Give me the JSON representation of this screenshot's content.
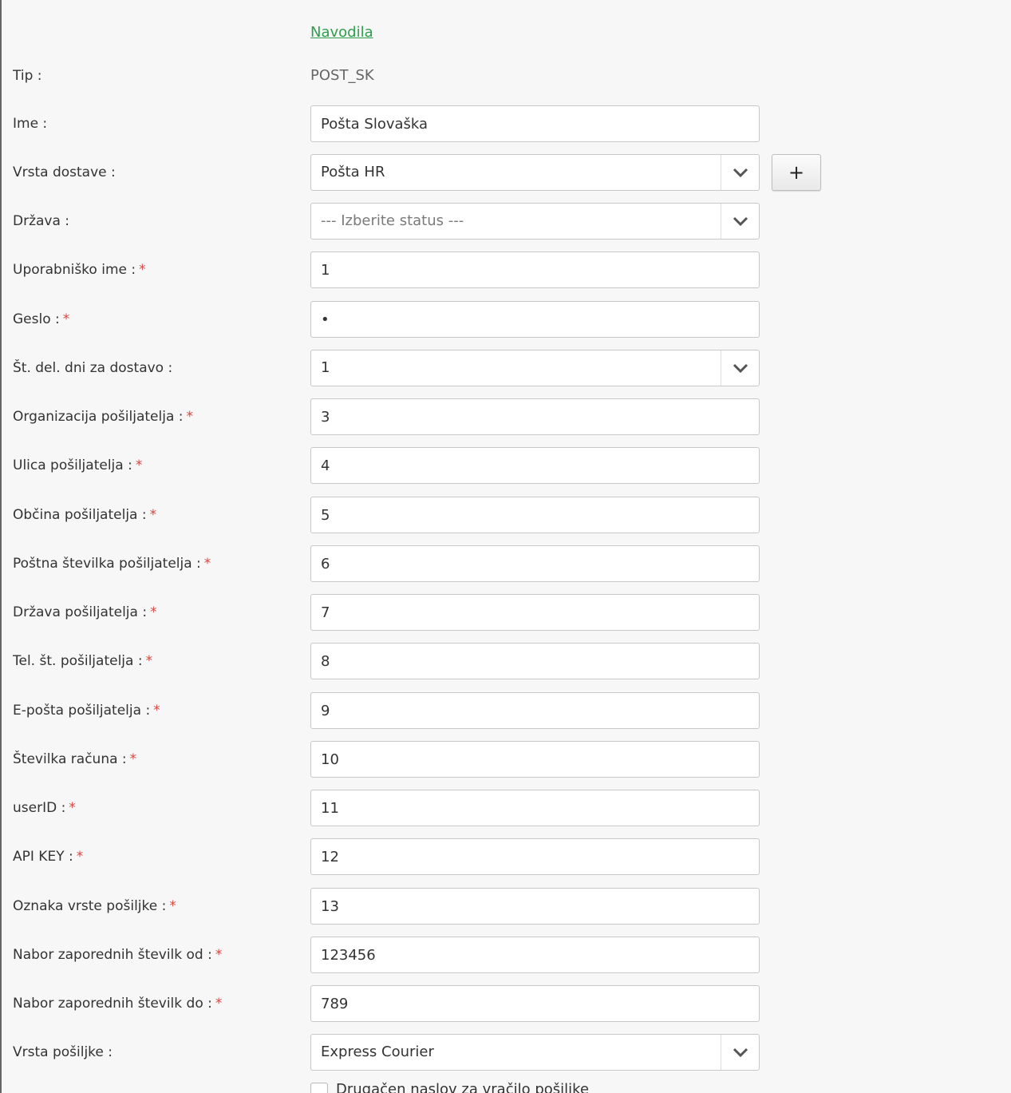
{
  "help_link": "Navodila",
  "form": {
    "tip": {
      "label": "Tip :",
      "value": "POST_SK"
    },
    "ime": {
      "label": "Ime :",
      "value": "Pošta Slovaška"
    },
    "vrsta_dostave": {
      "label": "Vrsta dostave :",
      "selected": "Pošta HR",
      "add_label": "+"
    },
    "drzava": {
      "label": "Država :",
      "placeholder": "--- Izberite status ---"
    },
    "uporabnisko_ime": {
      "label": "Uporabniško ime :",
      "value": "1",
      "required": "*"
    },
    "geslo": {
      "label": "Geslo :",
      "value": "•",
      "required": "*"
    },
    "st_del_dni": {
      "label": "Št. del. dni za dostavo :",
      "selected": "1"
    },
    "organizacija": {
      "label": "Organizacija pošiljatelja :",
      "value": "3",
      "required": "*"
    },
    "ulica": {
      "label": "Ulica pošiljatelja :",
      "value": "4",
      "required": "*"
    },
    "obcina": {
      "label": "Občina pošiljatelja :",
      "value": "5",
      "required": "*"
    },
    "postna_stevilka": {
      "label": "Poštna številka pošiljatelja :",
      "value": "6",
      "required": "*"
    },
    "drzava_posiljatelja": {
      "label": "Država pošiljatelja :",
      "value": "7",
      "required": "*"
    },
    "tel": {
      "label": "Tel. št. pošiljatelja :",
      "value": "8",
      "required": "*"
    },
    "eposta": {
      "label": "E-pošta pošiljatelja :",
      "value": "9",
      "required": "*"
    },
    "stevilka_racuna": {
      "label": "Številka računa :",
      "value": "10",
      "required": "*"
    },
    "user_id": {
      "label": "userID :",
      "value": "11",
      "required": "*"
    },
    "api_key": {
      "label": "API KEY :",
      "value": "12",
      "required": "*"
    },
    "oznaka_vrste": {
      "label": "Oznaka vrste pošiljke :",
      "value": "13",
      "required": "*"
    },
    "nabor_od": {
      "label": "Nabor zaporednih številk od :",
      "value": "123456",
      "required": "*"
    },
    "nabor_do": {
      "label": "Nabor zaporednih številk do :",
      "value": "789",
      "required": "*"
    },
    "vrsta_posiljke": {
      "label": "Vrsta pošiljke :",
      "selected": "Express Courier"
    },
    "drugacen_naslov": {
      "label": "Drugačen naslov za vračilo pošiljke"
    }
  },
  "colors": {
    "link": "#2e9e4e",
    "required": "#d9453d",
    "border": "#c8c8c8",
    "background": "#f7f7f7"
  },
  "icons": {
    "select_arrow": "chevron-down-icon",
    "add": "plus-icon"
  }
}
